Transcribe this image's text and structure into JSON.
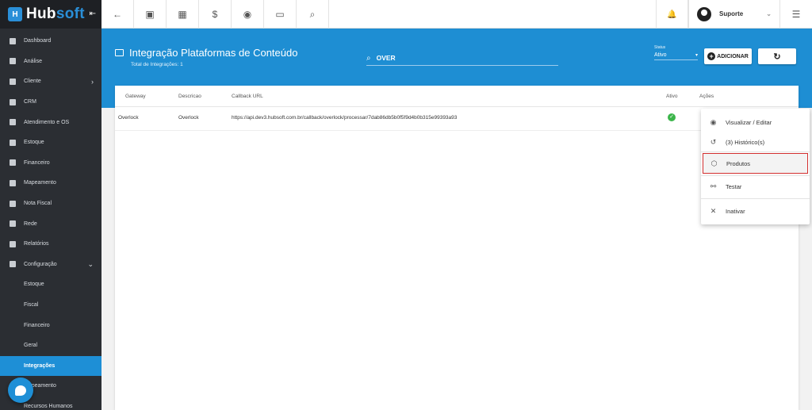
{
  "brand": {
    "name_a": "Hub",
    "name_b": "soft",
    "collapse_glyph": "⇤"
  },
  "sidebar": {
    "items": [
      {
        "label": "Dashboard",
        "icon": "dashboard-icon"
      },
      {
        "label": "Análise",
        "icon": "analysis-icon"
      },
      {
        "label": "Cliente",
        "icon": "client-icon",
        "arrow": "›"
      },
      {
        "label": "CRM",
        "icon": "crm-icon"
      },
      {
        "label": "Atendimento e OS",
        "icon": "calendar-icon"
      },
      {
        "label": "Estoque",
        "icon": "box-icon"
      },
      {
        "label": "Financeiro",
        "icon": "money-icon"
      },
      {
        "label": "Mapeamento",
        "icon": "map-pin-icon"
      },
      {
        "label": "Nota Fiscal",
        "icon": "invoice-icon"
      },
      {
        "label": "Rede",
        "icon": "network-icon"
      },
      {
        "label": "Relatórios",
        "icon": "report-icon"
      },
      {
        "label": "Configuração",
        "icon": "gear-icon",
        "arrow": "⌄"
      }
    ],
    "subitems": [
      "Estoque",
      "Fiscal",
      "Financeiro",
      "Geral",
      "Integrações",
      "Mapeamento",
      "Recursos Humanos"
    ],
    "active_sub": "Integrações"
  },
  "topbar": {
    "back": "←",
    "icons": [
      "client-card-icon",
      "calendar-icon",
      "dollar-icon",
      "eye-icon",
      "terminal-icon",
      "search-icon"
    ],
    "icon_glyphs": [
      "▣",
      "▦",
      "$",
      "◉",
      "▭",
      "⌕"
    ],
    "bell": "🔔",
    "user_name": "Suporte",
    "user_chev": "⌄",
    "list_glyph": "☰"
  },
  "header": {
    "title": "Integração Plataformas de Conteúdo",
    "subtitle": "Total de Integrações: 1"
  },
  "search": {
    "value": "OVER",
    "icon": "⌕"
  },
  "status": {
    "label": "Status",
    "value": "Ativo",
    "caret": "▾"
  },
  "buttons": {
    "add_label": "ADICIONAR",
    "add_plus": "+",
    "refresh_glyph": "↻"
  },
  "table": {
    "columns": [
      "Gateway",
      "Descricao",
      "Callback URL",
      "Ativo",
      "Ações"
    ],
    "rows": [
      {
        "gateway": "Overlock",
        "descricao": "Overlock",
        "callback_url": "https://api.dev3.hubsoft.com.br/callback/overlock/processar/7dab86db5b0f5f9d4b0b315e99393a93",
        "ativo_glyph": "✓"
      }
    ]
  },
  "actions_menu": [
    {
      "label": "Visualizar / Editar",
      "icon_glyph": "◉",
      "highlight": false
    },
    {
      "label": "(3) Histórico(s)",
      "icon_glyph": "↺",
      "highlight": false
    },
    {
      "label": "Produtos",
      "icon_glyph": "⬡",
      "highlight": true
    },
    {
      "label": "Testar",
      "icon_glyph": "⚯",
      "highlight": false
    },
    {
      "label": "Inativar",
      "icon_glyph": "✕",
      "highlight": false
    }
  ]
}
